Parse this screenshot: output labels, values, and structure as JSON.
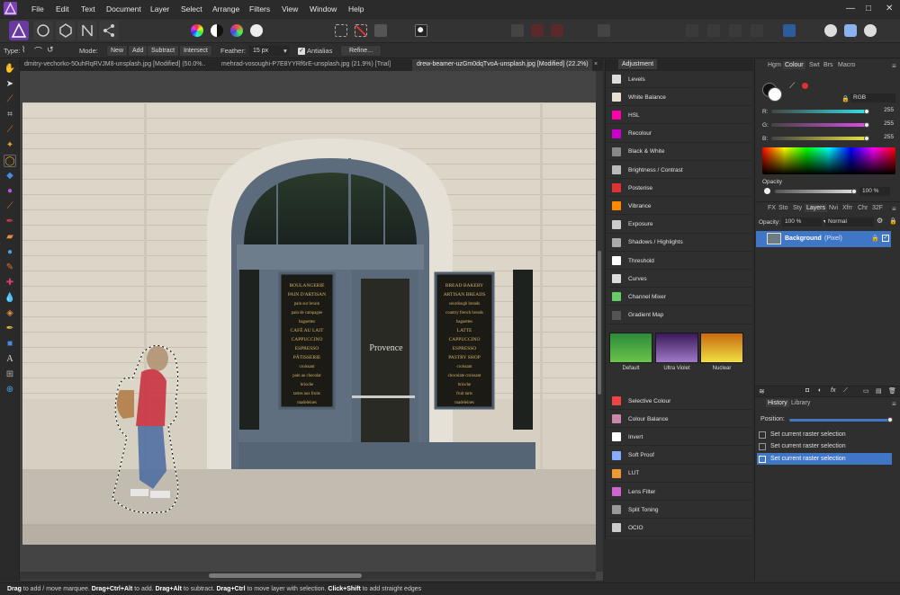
{
  "menu": [
    "File",
    "Edit",
    "Text",
    "Document",
    "Layer",
    "Select",
    "Arrange",
    "Filters",
    "View",
    "Window",
    "Help"
  ],
  "window_controls": [
    "—",
    "□",
    "✕"
  ],
  "context": {
    "type_label": "Type:",
    "mode_label": "Mode:",
    "modes": [
      "New",
      "Add",
      "Subtract",
      "Intersect"
    ],
    "feather_label": "Feather:",
    "feather_value": "15 px",
    "antialias_label": "Antialias",
    "refine_label": "Refine..."
  },
  "tabs": [
    "dmitry-vechorko-50uhRqRVJM8-unsplash.jpg [Modified] (50.0%...",
    "mehrad-vosoughi-P7E8YYRf6rE-unsplash.jpg (21.9%) [Trial]",
    "drew-beamer-uzGm0dqTvoA-unsplash.jpg [Modified] (22.2%)"
  ],
  "tab_close": "×",
  "adjustment": {
    "title": "Adjustment",
    "items_top": [
      "Levels",
      "White Balance",
      "HSL",
      "Recolour",
      "Black & White",
      "Brightness / Contrast",
      "Posterise",
      "Vibrance",
      "Exposure",
      "Shadows / Highlights",
      "Threshold",
      "Curves",
      "Channel Mixer",
      "Gradient Map"
    ],
    "presets": [
      "Default",
      "Ultra Violet",
      "Nuclear"
    ],
    "items_bottom": [
      "Selective Colour",
      "Colour Balance",
      "Invert",
      "Soft Proof",
      "LUT",
      "Lens Filter",
      "Split Toning",
      "OCIO"
    ]
  },
  "color_panel": {
    "tabs": [
      "Hgm",
      "Colour",
      "Swt",
      "Brs",
      "Macro"
    ],
    "model": "RGB",
    "channels": [
      {
        "label": "R:",
        "value": "255",
        "color": "#33e0e6"
      },
      {
        "label": "G:",
        "value": "255",
        "color": "#e04be8"
      },
      {
        "label": "B:",
        "value": "255",
        "color": "#e8e040"
      }
    ],
    "opacity_label": "Opacity",
    "opacity_value": "100 %"
  },
  "layers_panel": {
    "tabs": [
      "FX",
      "Sto",
      "Sty",
      "Layers",
      "Nvi",
      "Xfrr",
      "Chr",
      "32F"
    ],
    "opacity_label": "Opacity:",
    "opacity_value": "100 %",
    "blend_mode": "Normal",
    "layer_name": "Background",
    "layer_type": "(Pixel)"
  },
  "history_panel": {
    "tabs": [
      "History",
      "Library"
    ],
    "position_label": "Position:",
    "position_value": 1.0,
    "entries": [
      "Set current raster selection",
      "Set current raster selection",
      "Set current raster selection"
    ]
  },
  "status": {
    "k1": "Drag",
    "t1": " to add / move marquee. ",
    "k2": "Drag+Ctrl+Alt",
    "t2": " to add. ",
    "k3": "Drag+Alt",
    "t3": " to subtract. ",
    "k4": "Drag+Ctrl",
    "t4": " to move layer with selection. ",
    "k5": "Click+Shift",
    "t5": " to add straight edges"
  },
  "photo_sign": {
    "brand": "Provence",
    "left_panel": [
      "BOULANGERIE",
      "PAIN D'ARTISAN",
      "pain sur levain",
      "pain de campagne",
      "baguettes",
      "CAFÉ AU LAIT",
      "CAPPUCCINO",
      "ESPRESSO",
      "PÂTISSERIE",
      "croissant",
      "pain au chocolat",
      "brioche",
      "tartes aux fruits",
      "madeleines"
    ],
    "right_panel": [
      "BREAD BAKERY",
      "ARTISAN BREADS",
      "sourdough breads",
      "country french breads",
      "baguettes",
      "LATTE",
      "CAPPUCCINO",
      "ESPRESSO",
      "PASTRY SHOP",
      "croissant",
      "chocolate croissant",
      "brioche",
      "fruit tarts",
      "madeleines"
    ]
  },
  "accent": "#3f76c6"
}
